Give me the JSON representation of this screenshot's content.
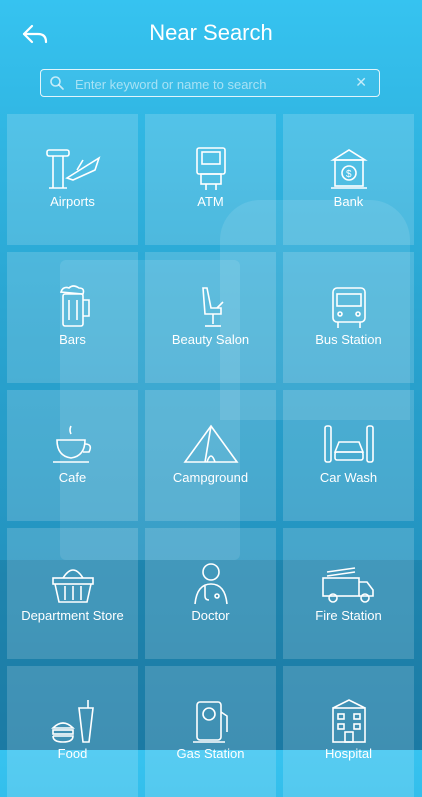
{
  "header": {
    "title": "Near Search",
    "back_icon": "back-arrow-icon"
  },
  "search": {
    "placeholder": "Enter keyword or name to search",
    "value": "",
    "clear_label": "✕"
  },
  "categories": [
    {
      "label": "Airports",
      "icon": "airport-icon"
    },
    {
      "label": "ATM",
      "icon": "atm-icon"
    },
    {
      "label": "Bank",
      "icon": "bank-icon"
    },
    {
      "label": "Bars",
      "icon": "beer-icon"
    },
    {
      "label": "Beauty Salon",
      "icon": "salon-chair-icon"
    },
    {
      "label": "Bus Station",
      "icon": "bus-icon"
    },
    {
      "label": "Cafe",
      "icon": "coffee-cup-icon"
    },
    {
      "label": "Campground",
      "icon": "tent-icon"
    },
    {
      "label": "Car Wash",
      "icon": "car-wash-icon"
    },
    {
      "label": "Department Store",
      "icon": "shopping-basket-icon"
    },
    {
      "label": "Doctor",
      "icon": "doctor-icon"
    },
    {
      "label": "Fire Station",
      "icon": "fire-truck-icon"
    },
    {
      "label": "Food",
      "icon": "food-icon"
    },
    {
      "label": "Gas Station",
      "icon": "gas-pump-icon"
    },
    {
      "label": "Hospital",
      "icon": "hospital-icon"
    }
  ]
}
